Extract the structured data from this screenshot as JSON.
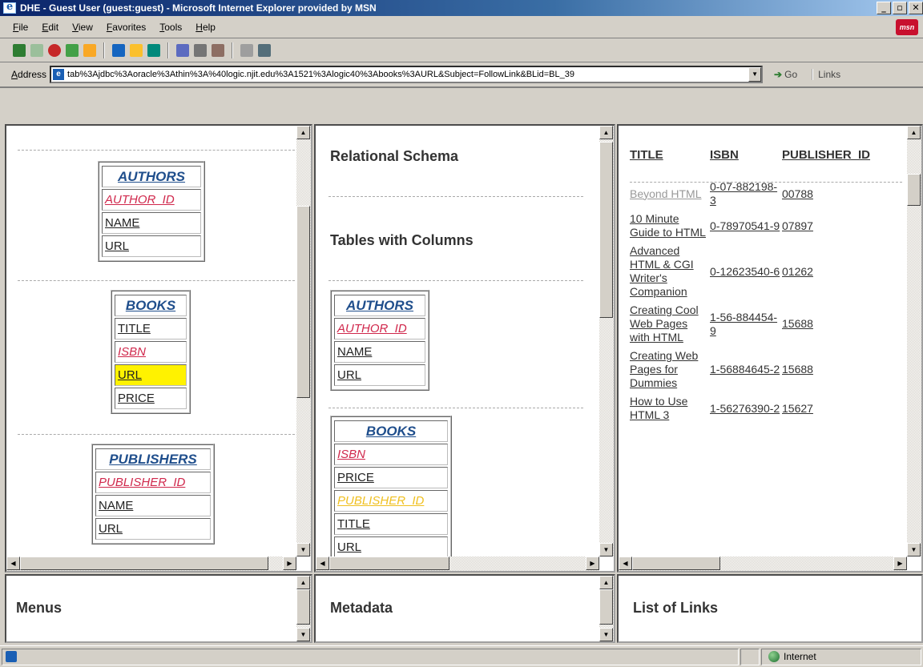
{
  "window": {
    "title": "DHE - Guest User (guest:guest) - Microsoft Internet Explorer provided by MSN",
    "logo_text": "msn"
  },
  "menu": [
    "File",
    "Edit",
    "View",
    "Favorites",
    "Tools",
    "Help"
  ],
  "address": {
    "label": "Address",
    "url": "tab%3Ajdbc%3Aoracle%3Athin%3A%40logic.njit.edu%3A1521%3Alogic40%3Abooks%3AURL&Subject=FollowLink&BLid=BL_39",
    "go_label": "Go",
    "links_label": "Links"
  },
  "left_frame": {
    "entities": [
      {
        "name": "AUTHORS",
        "cells": [
          {
            "text": "AUTHOR_ID",
            "kind": "pk"
          },
          {
            "text": "NAME",
            "kind": "normal"
          },
          {
            "text": "URL",
            "kind": "normal"
          }
        ]
      },
      {
        "name": "BOOKS",
        "cells": [
          {
            "text": "TITLE",
            "kind": "normal"
          },
          {
            "text": "ISBN",
            "kind": "pk"
          },
          {
            "text": "URL",
            "kind": "highlight"
          },
          {
            "text": "PRICE",
            "kind": "normal"
          }
        ]
      },
      {
        "name": "PUBLISHERS",
        "cells": [
          {
            "text": "PUBLISHER_ID",
            "kind": "pk"
          },
          {
            "text": "NAME",
            "kind": "normal"
          },
          {
            "text": "URL",
            "kind": "normal"
          }
        ]
      }
    ]
  },
  "middle_frame": {
    "heading_1": "Relational Schema",
    "heading_2": "Tables with Columns",
    "entities": [
      {
        "name": "AUTHORS",
        "cells": [
          {
            "text": "AUTHOR_ID",
            "kind": "pk"
          },
          {
            "text": "NAME",
            "kind": "normal"
          },
          {
            "text": "URL",
            "kind": "normal"
          }
        ]
      },
      {
        "name": "BOOKS",
        "cells": [
          {
            "text": "ISBN",
            "kind": "pk"
          },
          {
            "text": "PRICE",
            "kind": "normal"
          },
          {
            "text": "PUBLISHER_ID",
            "kind": "fk"
          },
          {
            "text": "TITLE",
            "kind": "normal"
          },
          {
            "text": "URL",
            "kind": "normal"
          }
        ]
      }
    ]
  },
  "right_frame": {
    "columns": [
      "TITLE",
      "ISBN",
      "PUBLISHER_ID"
    ],
    "rows": [
      {
        "title": "Beyond HTML",
        "isbn": "0-07-882198-3",
        "publisher_id": "00788",
        "visited": true
      },
      {
        "title": "10 Minute Guide to HTML",
        "isbn": "0-78970541-9",
        "publisher_id": "07897",
        "visited": false
      },
      {
        "title": "Advanced HTML & CGI Writer's Companion",
        "isbn": "0-12623540-6",
        "publisher_id": "01262",
        "visited": false
      },
      {
        "title": "Creating Cool Web Pages with HTML",
        "isbn": "1-56-884454-9",
        "publisher_id": "15688",
        "visited": false
      },
      {
        "title": "Creating Web Pages for Dummies",
        "isbn": "1-56884645-2",
        "publisher_id": "15688",
        "visited": false
      },
      {
        "title": "How to Use HTML 3",
        "isbn": "1-56276390-2",
        "publisher_id": "15627",
        "visited": false
      }
    ]
  },
  "bottom_frames": {
    "menus": "Menus",
    "metadata": "Metadata",
    "links": "List of Links"
  },
  "status": {
    "zone": "Internet"
  }
}
